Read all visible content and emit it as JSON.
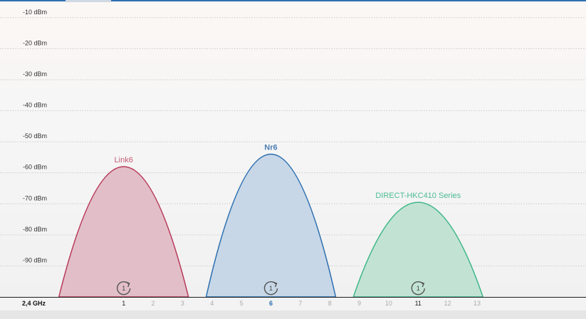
{
  "chart_data": {
    "type": "area",
    "title": "",
    "xlabel": "2,4 GHz",
    "ylabel": "",
    "x_ticks": [
      {
        "label": "1",
        "value": 1,
        "highlight": "dark"
      },
      {
        "label": "2",
        "value": 2
      },
      {
        "label": "3",
        "value": 3
      },
      {
        "label": "4",
        "value": 4
      },
      {
        "label": "5",
        "value": 5
      },
      {
        "label": "6",
        "value": 6,
        "highlight": "blue"
      },
      {
        "label": "7",
        "value": 7
      },
      {
        "label": "8",
        "value": 8
      },
      {
        "label": "9",
        "value": 9
      },
      {
        "label": "10",
        "value": 10
      },
      {
        "label": "11",
        "value": 11,
        "highlight": "dark"
      },
      {
        "label": "12",
        "value": 12
      },
      {
        "label": "13",
        "value": 13
      }
    ],
    "y_ticks": [
      {
        "label": "-10 dBm",
        "value": -10
      },
      {
        "label": "-20 dBm",
        "value": -20
      },
      {
        "label": "-30 dBm",
        "value": -30
      },
      {
        "label": "-40 dBm",
        "value": -40
      },
      {
        "label": "-50 dBm",
        "value": -50
      },
      {
        "label": "-60 dBm",
        "value": -60
      },
      {
        "label": "-70 dBm",
        "value": -70
      },
      {
        "label": "-80 dBm",
        "value": -80
      },
      {
        "label": "-90 dBm",
        "value": -90
      }
    ],
    "xlim": [
      -3.2,
      16.7
    ],
    "ylim": [
      -100,
      -5
    ],
    "grid": true,
    "series": [
      {
        "name": "Link6",
        "channel": 1,
        "peak_dbm": -58,
        "width_channels": 4.4,
        "stroke": "#b83a5a",
        "fill": "#e0bcc5",
        "label_color": "#c55a74",
        "icon_name": "refresh-channel-icon",
        "icon_label": "1"
      },
      {
        "name": "Nr6",
        "channel": 6,
        "peak_dbm": -54,
        "width_channels": 4.4,
        "stroke": "#2c6fb0",
        "fill": "#c4d5e6",
        "label_color": "#4a7fb5",
        "icon_name": "refresh-channel-icon",
        "icon_label": "1"
      },
      {
        "name": "DIRECT-HKC410 Series",
        "channel": 11,
        "peak_dbm": -69.5,
        "width_channels": 4.4,
        "stroke": "#3fb68a",
        "fill": "#bfe1d1",
        "label_color": "#4cbb93",
        "icon_name": "refresh-channel-icon",
        "icon_label": "1"
      }
    ]
  }
}
